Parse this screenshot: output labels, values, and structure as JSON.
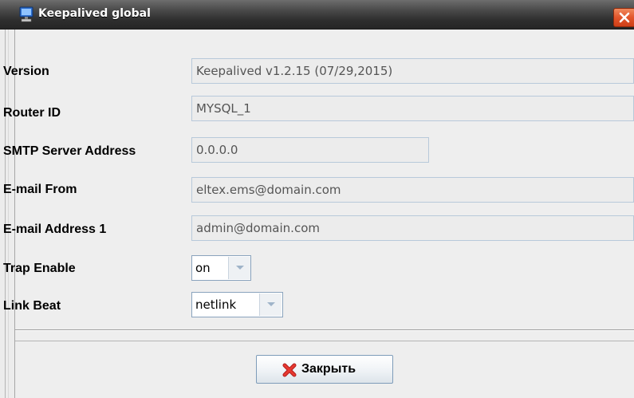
{
  "window": {
    "title": "Keepalived global",
    "title_icon": "monitor-icon",
    "close_icon": "close-x-icon"
  },
  "form": {
    "version": {
      "label": "Version",
      "value": "Keepalived v1.2.15 (07/29,2015)"
    },
    "router_id": {
      "label": "Router ID",
      "value": "MYSQL_1"
    },
    "smtp": {
      "label": "SMTP Server Address",
      "value": "0.0.0.0"
    },
    "email_from": {
      "label": "E-mail From",
      "value": "eltex.ems@domain.com"
    },
    "email_address_1": {
      "label": "E-mail Address 1",
      "value": "admin@domain.com"
    },
    "trap_enable": {
      "label": "Trap Enable",
      "value": "on",
      "icon": "chevron-down-icon"
    },
    "link_beat": {
      "label": "Link Beat",
      "value": "netlink",
      "icon": "chevron-down-icon"
    }
  },
  "footer": {
    "close_button_label": "Закрыть",
    "close_button_icon": "red-x-icon"
  },
  "colors": {
    "titlebar": "#2e2e2e",
    "close_accent": "#e2552b",
    "field_border": "#b8c9da",
    "button_border": "#7e9cb9"
  }
}
